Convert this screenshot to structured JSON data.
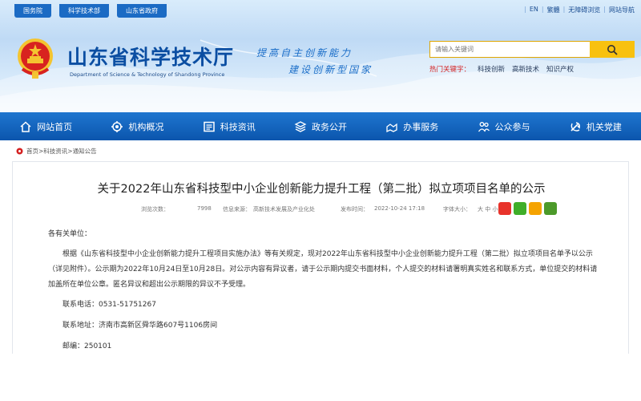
{
  "top_links": [
    "国务院",
    "科学技术部",
    "山东省政府"
  ],
  "lang_links": [
    "EN",
    "繁體",
    "无障碍浏览",
    "网站导航"
  ],
  "site": {
    "name": "山东省科学技术厅",
    "name_en": "Department of Science & Technology of Shandong Province",
    "slogan_line1": "提高自主创新能力",
    "slogan_line2": "建设创新型国家"
  },
  "search": {
    "placeholder": "请输入关键词"
  },
  "hot": {
    "label": "热门关键字：",
    "keywords": [
      "科技创新",
      "高新技术",
      "知识产权"
    ]
  },
  "nav": [
    {
      "label": "网站首页",
      "icon": "home-icon"
    },
    {
      "label": "机构概况",
      "icon": "gear-org-icon"
    },
    {
      "label": "科技资讯",
      "icon": "news-icon"
    },
    {
      "label": "政务公开",
      "icon": "layers-icon"
    },
    {
      "label": "办事服务",
      "icon": "service-icon"
    },
    {
      "label": "公众参与",
      "icon": "people-icon"
    },
    {
      "label": "机关党建",
      "icon": "party-icon"
    }
  ],
  "breadcrumb": "首页>科技资讯>通知公告",
  "article": {
    "title": "关于2022年山东省科技型中小企业创新能力提升工程（第二批）拟立项项目名单的公示",
    "views_label": "浏览次数：",
    "views": "7998",
    "source_label": "信息来源：",
    "source": "高新技术发展及产业化处",
    "date_label": "发布时间：",
    "date": "2022-10-24 17:18",
    "fontsize_label": "字体大小：",
    "fontsize_options": "大 中 小",
    "salutation": "各有关单位：",
    "paragraph": "根据《山东省科技型中小企业创新能力提升工程项目实施办法》等有关规定，现对2022年山东省科技型中小企业创新能力提升工程（第二批）拟立项项目名单予以公示（详见附件）。公示期为2022年10月24日至10月28日。对公示内容有异议者，请于公示期内提交书面材料，个人提交的材料请署明真实姓名和联系方式，单位提交的材料请加盖所在单位公章。匿名异议和超出公示期限的异议不予受理。",
    "phone": "联系电话：0531-51751267",
    "address": "联系地址：济南市高新区舜华路607号1106房间",
    "postcode": "邮编：250101"
  },
  "colors": {
    "nav_blue": "#0b55ad",
    "brand_blue": "#0b4ea2",
    "search_yellow": "#f8c10f",
    "hot_red": "#d42020"
  }
}
